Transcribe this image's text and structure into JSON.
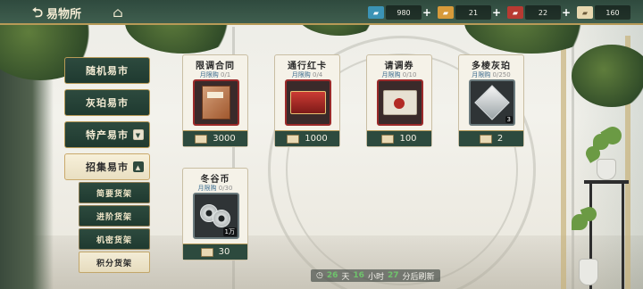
{
  "colors": {
    "topbar": "#2f4a3e",
    "gold_border": "#b79a57",
    "limit_text": "#3b6c8f",
    "countdown_green": "#6fc46c"
  },
  "header": {
    "back_label": "易物所",
    "back_icon": "back-arrow-icon",
    "home_icon": "home-icon",
    "currencies": [
      {
        "icon": "blue-ticket-icon",
        "value": "980"
      },
      {
        "icon": "gold-ticket-icon",
        "value": "21"
      },
      {
        "icon": "red-ticket-icon",
        "value": "22"
      },
      {
        "icon": "beige-ticket-icon",
        "value": "160"
      }
    ]
  },
  "sidebar": {
    "items": [
      {
        "label": "随机易市"
      },
      {
        "label": "灰珀易市"
      },
      {
        "label": "特产易市"
      },
      {
        "label": "招集易市"
      }
    ],
    "sub_items": [
      {
        "label": "简要货架"
      },
      {
        "label": "进阶货架"
      },
      {
        "label": "机密货架"
      },
      {
        "label": "积分货架"
      }
    ]
  },
  "items": [
    {
      "name": "限调合同",
      "limit_label": "月限购",
      "limit_count": "0/1",
      "price": "3000",
      "qty": ""
    },
    {
      "name": "通行红卡",
      "limit_label": "月限购",
      "limit_count": "0/4",
      "price": "1000",
      "qty": ""
    },
    {
      "name": "请调券",
      "limit_label": "月限购",
      "limit_count": "0/10",
      "price": "100",
      "qty": ""
    },
    {
      "name": "多棱灰珀",
      "limit_label": "月限购",
      "limit_count": "0/250",
      "price": "2",
      "qty": "3"
    },
    {
      "name": "冬谷币",
      "limit_label": "月限购",
      "limit_count": "0/30",
      "price": "30",
      "qty": "1万"
    }
  ],
  "refresh": {
    "days": "26",
    "day_unit": "天",
    "hours": "16",
    "hour_unit": "小时",
    "minutes": "27",
    "suffix": "分后刷新"
  }
}
